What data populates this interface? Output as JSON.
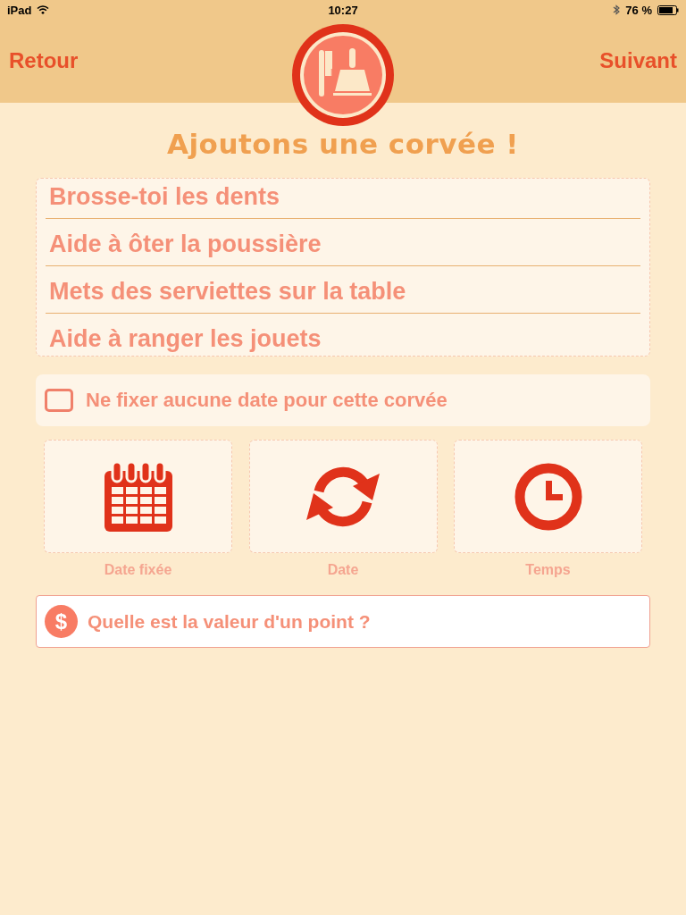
{
  "status_bar": {
    "device": "iPad",
    "time": "10:27",
    "battery": "76 %"
  },
  "nav": {
    "back": "Retour",
    "next": "Suivant"
  },
  "title": "Ajoutons une corvée !",
  "chores": [
    {
      "label": "Brosse-toi les dents"
    },
    {
      "label": "Aide à ôter la poussière"
    },
    {
      "label": "Mets des serviettes sur la table"
    },
    {
      "label": "Aide à ranger les jouets"
    }
  ],
  "no_date": {
    "label": "Ne fixer aucune date pour cette corvée",
    "checked": false
  },
  "options": [
    {
      "kind": "calendar",
      "label": "Date fixée"
    },
    {
      "kind": "repeat",
      "label": "Date"
    },
    {
      "kind": "clock",
      "label": "Temps"
    }
  ],
  "point_value": {
    "symbol": "$",
    "placeholder": "Quelle est la valeur d'un point ?"
  }
}
